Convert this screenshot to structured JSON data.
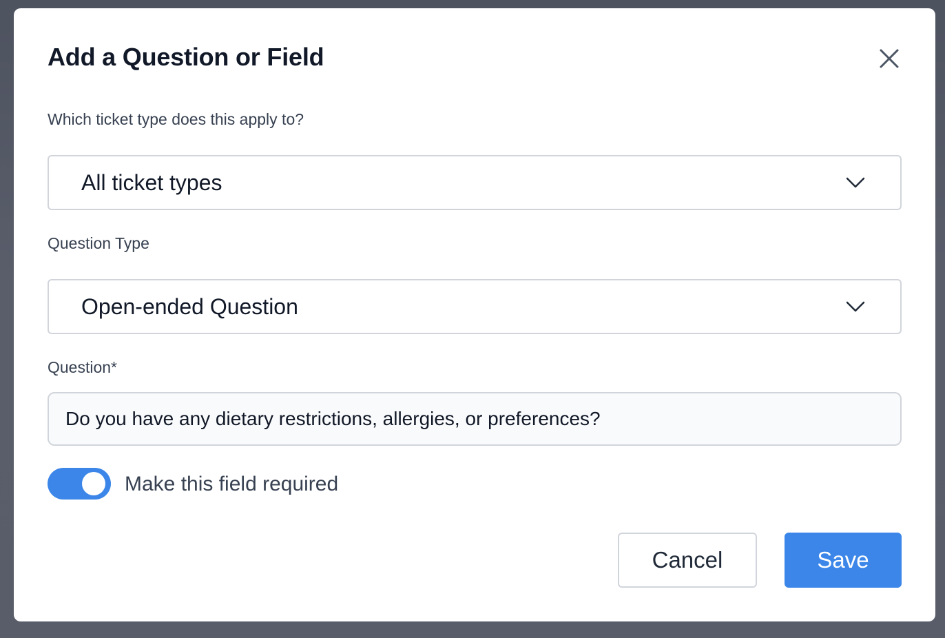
{
  "modal": {
    "title": "Add a Question or Field",
    "close_icon": "close-icon"
  },
  "ticket_type": {
    "label": "Which ticket type does this apply to?",
    "selected": "All ticket types",
    "icon": "chevron-down-icon"
  },
  "question_type": {
    "label": "Question Type",
    "selected": "Open-ended Question",
    "icon": "chevron-down-icon"
  },
  "question": {
    "label": "Question*",
    "value": "Do you have any dietary restrictions, allergies, or preferences?"
  },
  "required_toggle": {
    "label": "Make this field required",
    "on": true,
    "color": "#3b86e8"
  },
  "actions": {
    "cancel_label": "Cancel",
    "save_label": "Save"
  },
  "colors": {
    "accent": "#3b86e8",
    "backdrop": "#565a67"
  }
}
